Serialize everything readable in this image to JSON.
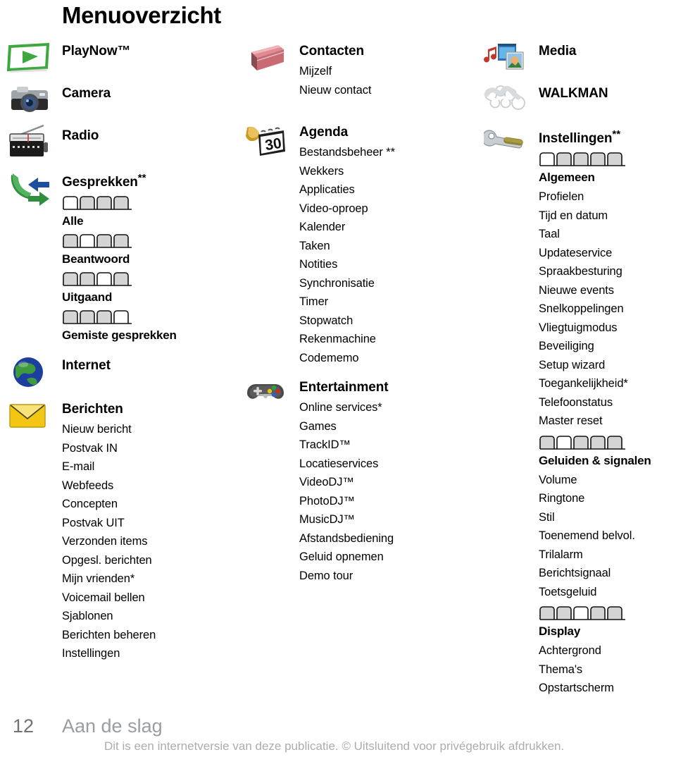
{
  "document": {
    "title": "Menuoverzicht"
  },
  "columns": {
    "left": [
      {
        "icon": "playnow-icon",
        "heading": "PlayNow™",
        "items": []
      },
      {
        "icon": "camera-icon",
        "heading": "Camera",
        "items": []
      },
      {
        "icon": "radio-icon",
        "heading": "Radio",
        "items": []
      },
      {
        "icon": "calls-icon",
        "heading": "Gesprekken",
        "heading_marker": "**",
        "tab_sections": [
          {
            "tabs": 4,
            "active": 1,
            "label": "Alle"
          },
          {
            "tabs": 4,
            "active": 2,
            "label": "Beantwoord"
          },
          {
            "tabs": 4,
            "active": 3,
            "label": "Uitgaand"
          },
          {
            "tabs": 4,
            "active": 4,
            "label": "Gemiste gesprekken"
          }
        ]
      },
      {
        "icon": "internet-globe-icon",
        "heading": "Internet",
        "items": []
      },
      {
        "icon": "messaging-envelope-icon",
        "heading": "Berichten",
        "items": [
          "Nieuw bericht",
          "Postvak IN",
          "E-mail",
          "Webfeeds",
          "Concepten",
          "Postvak UIT",
          "Verzonden items",
          "Opgesl. berichten",
          "Mijn vrienden*",
          "Voicemail bellen",
          "Sjablonen",
          "Berichten beheren",
          "Instellingen"
        ]
      }
    ],
    "middle": [
      {
        "icon": "contacts-book-icon",
        "heading": "Contacten",
        "items": [
          "Mijzelf",
          "Nieuw contact"
        ]
      },
      {
        "icon": "organizer-calendar-icon",
        "heading": "Agenda",
        "items": [
          "Bestandsbeheer **",
          "Wekkers",
          "Applicaties",
          "Video-oproep",
          "Kalender",
          "Taken",
          "Notities",
          "Synchronisatie",
          "Timer",
          "Stopwatch",
          "Rekenmachine",
          "Codememo"
        ]
      },
      {
        "icon": "gamepad-icon",
        "heading": "Entertainment",
        "items": [
          "Online services*",
          "Games",
          "TrackID™",
          "Locatieservices",
          "VideoDJ™",
          "PhotoDJ™",
          "MusicDJ™",
          "Afstandsbediening",
          "Geluid opnemen",
          "Demo tour"
        ]
      }
    ],
    "right": [
      {
        "icon": "media-icon",
        "heading": "Media",
        "items": []
      },
      {
        "icon": "walkman-icon",
        "heading": "WALKMAN",
        "items": []
      },
      {
        "icon": "settings-wrench-icon",
        "heading": "Instellingen",
        "heading_marker": "**",
        "tab_groups": [
          {
            "tabs": 5,
            "active": 1,
            "label": "Algemeen",
            "items": [
              "Profielen",
              "Tijd en datum",
              "Taal",
              "Updateservice",
              "Spraakbesturing",
              "Nieuwe events",
              "Snelkoppelingen",
              "Vliegtuigmodus",
              "Beveiliging",
              "Setup wizard",
              "Toegankelijkheid*",
              "Telefoonstatus",
              "Master reset"
            ]
          },
          {
            "tabs": 5,
            "active": 2,
            "label": "Geluiden & signalen",
            "items": [
              "Volume",
              "Ringtone",
              "Stil",
              "Toenemend belvol.",
              "Trilalarm",
              "Berichtsignaal",
              "Toetsgeluid"
            ]
          },
          {
            "tabs": 5,
            "active": 3,
            "label": "Display",
            "items": [
              "Achtergrond",
              "Thema's",
              "Opstartscherm"
            ]
          }
        ]
      }
    ]
  },
  "footer": {
    "page_number": "12",
    "section": "Aan de slag",
    "note": "Dit is een internetversie van deze publicatie. © Uitsluitend voor privégebruik afdrukken."
  },
  "colors": {
    "tab_fill": "#d4d4d4",
    "tab_stroke": "#111111",
    "footer_section": "#9a9da1",
    "footer_note": "#a9acb0",
    "page_number": "#6f7277"
  }
}
